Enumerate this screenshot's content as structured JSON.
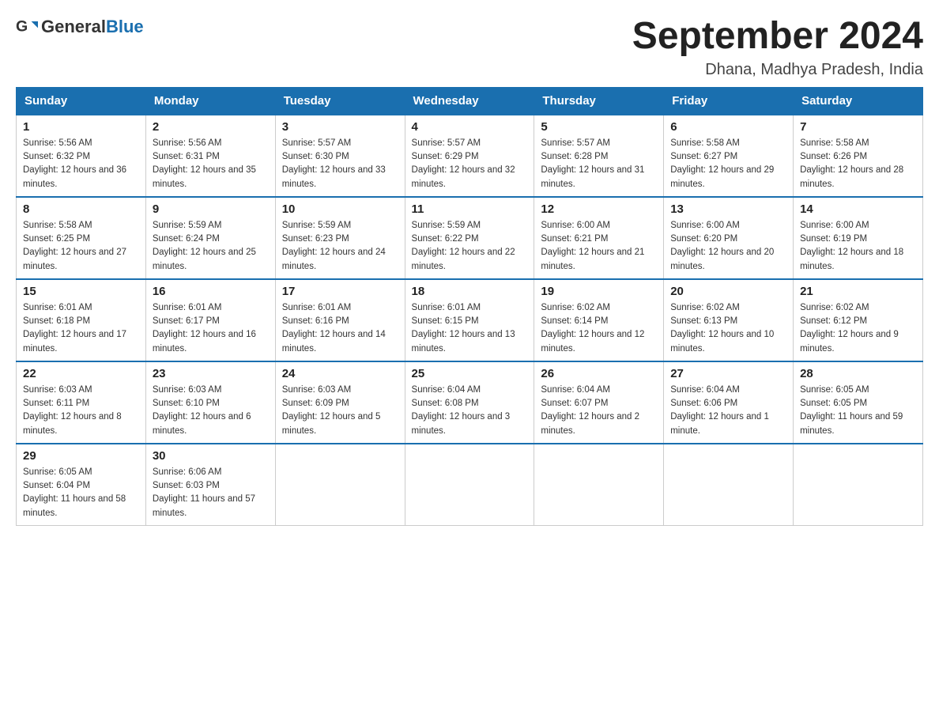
{
  "header": {
    "logo_general": "General",
    "logo_blue": "Blue",
    "month_year": "September 2024",
    "location": "Dhana, Madhya Pradesh, India"
  },
  "days_of_week": [
    "Sunday",
    "Monday",
    "Tuesday",
    "Wednesday",
    "Thursday",
    "Friday",
    "Saturday"
  ],
  "weeks": [
    [
      {
        "day": "1",
        "sunrise": "Sunrise: 5:56 AM",
        "sunset": "Sunset: 6:32 PM",
        "daylight": "Daylight: 12 hours and 36 minutes."
      },
      {
        "day": "2",
        "sunrise": "Sunrise: 5:56 AM",
        "sunset": "Sunset: 6:31 PM",
        "daylight": "Daylight: 12 hours and 35 minutes."
      },
      {
        "day": "3",
        "sunrise": "Sunrise: 5:57 AM",
        "sunset": "Sunset: 6:30 PM",
        "daylight": "Daylight: 12 hours and 33 minutes."
      },
      {
        "day": "4",
        "sunrise": "Sunrise: 5:57 AM",
        "sunset": "Sunset: 6:29 PM",
        "daylight": "Daylight: 12 hours and 32 minutes."
      },
      {
        "day": "5",
        "sunrise": "Sunrise: 5:57 AM",
        "sunset": "Sunset: 6:28 PM",
        "daylight": "Daylight: 12 hours and 31 minutes."
      },
      {
        "day": "6",
        "sunrise": "Sunrise: 5:58 AM",
        "sunset": "Sunset: 6:27 PM",
        "daylight": "Daylight: 12 hours and 29 minutes."
      },
      {
        "day": "7",
        "sunrise": "Sunrise: 5:58 AM",
        "sunset": "Sunset: 6:26 PM",
        "daylight": "Daylight: 12 hours and 28 minutes."
      }
    ],
    [
      {
        "day": "8",
        "sunrise": "Sunrise: 5:58 AM",
        "sunset": "Sunset: 6:25 PM",
        "daylight": "Daylight: 12 hours and 27 minutes."
      },
      {
        "day": "9",
        "sunrise": "Sunrise: 5:59 AM",
        "sunset": "Sunset: 6:24 PM",
        "daylight": "Daylight: 12 hours and 25 minutes."
      },
      {
        "day": "10",
        "sunrise": "Sunrise: 5:59 AM",
        "sunset": "Sunset: 6:23 PM",
        "daylight": "Daylight: 12 hours and 24 minutes."
      },
      {
        "day": "11",
        "sunrise": "Sunrise: 5:59 AM",
        "sunset": "Sunset: 6:22 PM",
        "daylight": "Daylight: 12 hours and 22 minutes."
      },
      {
        "day": "12",
        "sunrise": "Sunrise: 6:00 AM",
        "sunset": "Sunset: 6:21 PM",
        "daylight": "Daylight: 12 hours and 21 minutes."
      },
      {
        "day": "13",
        "sunrise": "Sunrise: 6:00 AM",
        "sunset": "Sunset: 6:20 PM",
        "daylight": "Daylight: 12 hours and 20 minutes."
      },
      {
        "day": "14",
        "sunrise": "Sunrise: 6:00 AM",
        "sunset": "Sunset: 6:19 PM",
        "daylight": "Daylight: 12 hours and 18 minutes."
      }
    ],
    [
      {
        "day": "15",
        "sunrise": "Sunrise: 6:01 AM",
        "sunset": "Sunset: 6:18 PM",
        "daylight": "Daylight: 12 hours and 17 minutes."
      },
      {
        "day": "16",
        "sunrise": "Sunrise: 6:01 AM",
        "sunset": "Sunset: 6:17 PM",
        "daylight": "Daylight: 12 hours and 16 minutes."
      },
      {
        "day": "17",
        "sunrise": "Sunrise: 6:01 AM",
        "sunset": "Sunset: 6:16 PM",
        "daylight": "Daylight: 12 hours and 14 minutes."
      },
      {
        "day": "18",
        "sunrise": "Sunrise: 6:01 AM",
        "sunset": "Sunset: 6:15 PM",
        "daylight": "Daylight: 12 hours and 13 minutes."
      },
      {
        "day": "19",
        "sunrise": "Sunrise: 6:02 AM",
        "sunset": "Sunset: 6:14 PM",
        "daylight": "Daylight: 12 hours and 12 minutes."
      },
      {
        "day": "20",
        "sunrise": "Sunrise: 6:02 AM",
        "sunset": "Sunset: 6:13 PM",
        "daylight": "Daylight: 12 hours and 10 minutes."
      },
      {
        "day": "21",
        "sunrise": "Sunrise: 6:02 AM",
        "sunset": "Sunset: 6:12 PM",
        "daylight": "Daylight: 12 hours and 9 minutes."
      }
    ],
    [
      {
        "day": "22",
        "sunrise": "Sunrise: 6:03 AM",
        "sunset": "Sunset: 6:11 PM",
        "daylight": "Daylight: 12 hours and 8 minutes."
      },
      {
        "day": "23",
        "sunrise": "Sunrise: 6:03 AM",
        "sunset": "Sunset: 6:10 PM",
        "daylight": "Daylight: 12 hours and 6 minutes."
      },
      {
        "day": "24",
        "sunrise": "Sunrise: 6:03 AM",
        "sunset": "Sunset: 6:09 PM",
        "daylight": "Daylight: 12 hours and 5 minutes."
      },
      {
        "day": "25",
        "sunrise": "Sunrise: 6:04 AM",
        "sunset": "Sunset: 6:08 PM",
        "daylight": "Daylight: 12 hours and 3 minutes."
      },
      {
        "day": "26",
        "sunrise": "Sunrise: 6:04 AM",
        "sunset": "Sunset: 6:07 PM",
        "daylight": "Daylight: 12 hours and 2 minutes."
      },
      {
        "day": "27",
        "sunrise": "Sunrise: 6:04 AM",
        "sunset": "Sunset: 6:06 PM",
        "daylight": "Daylight: 12 hours and 1 minute."
      },
      {
        "day": "28",
        "sunrise": "Sunrise: 6:05 AM",
        "sunset": "Sunset: 6:05 PM",
        "daylight": "Daylight: 11 hours and 59 minutes."
      }
    ],
    [
      {
        "day": "29",
        "sunrise": "Sunrise: 6:05 AM",
        "sunset": "Sunset: 6:04 PM",
        "daylight": "Daylight: 11 hours and 58 minutes."
      },
      {
        "day": "30",
        "sunrise": "Sunrise: 6:06 AM",
        "sunset": "Sunset: 6:03 PM",
        "daylight": "Daylight: 11 hours and 57 minutes."
      },
      null,
      null,
      null,
      null,
      null
    ]
  ]
}
